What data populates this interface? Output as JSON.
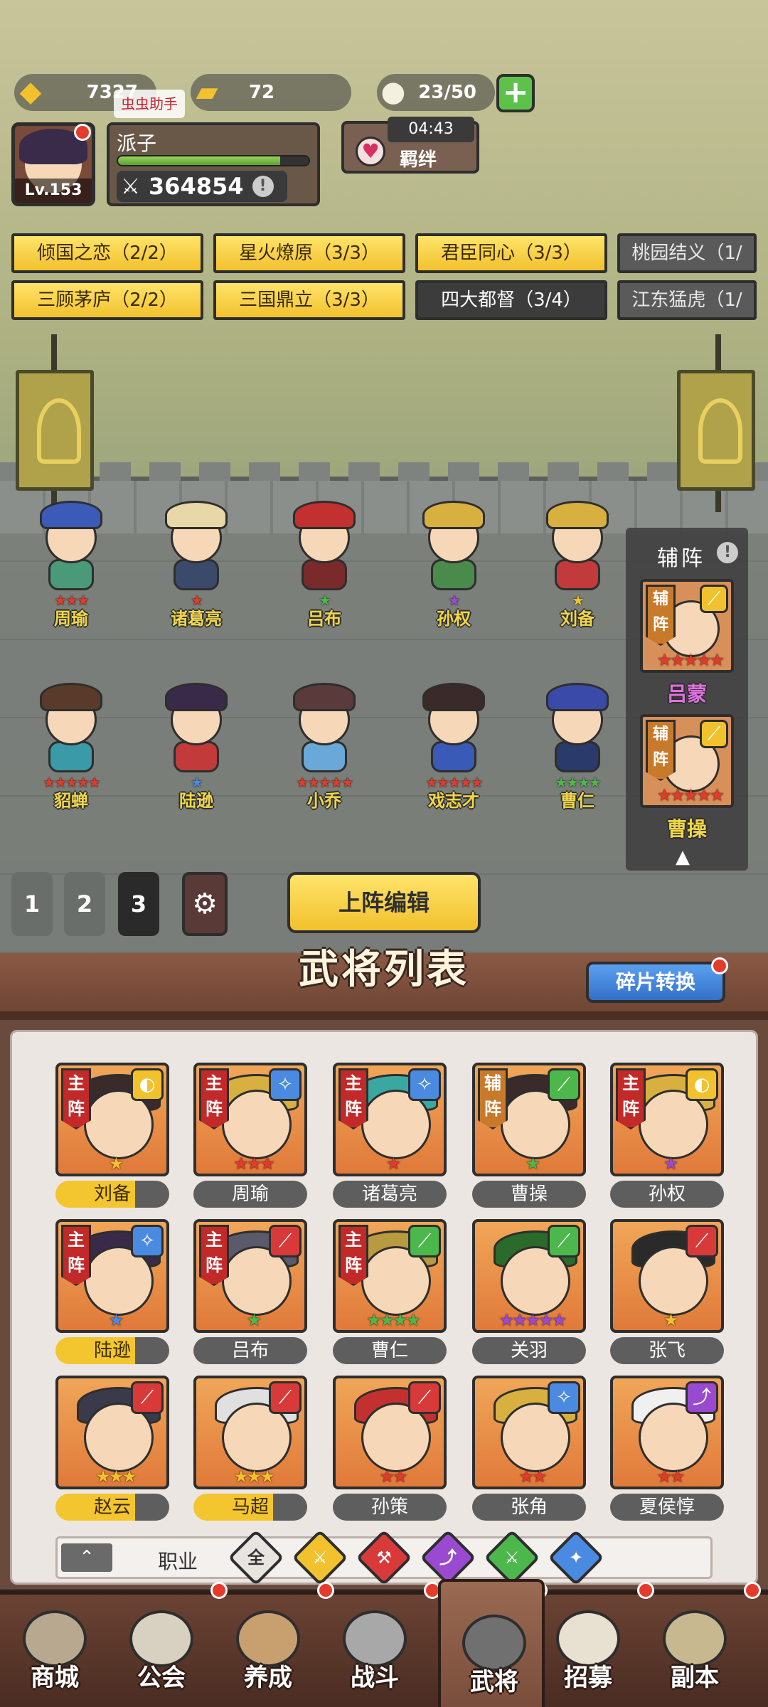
{
  "resources": {
    "gold": "7327",
    "tickets": "72",
    "stamina": "23/50",
    "plus": "+",
    "assistant_tag": "虫虫助手"
  },
  "player": {
    "level": "Lv.153",
    "name": "派子",
    "power": "364854",
    "info": "!",
    "xp_fraction": 0.85
  },
  "fetter": {
    "timer": "04:43",
    "label": "羁绊",
    "heart": "♥"
  },
  "synergies": [
    {
      "label": "倾国之恋（2/2）",
      "state": "on"
    },
    {
      "label": "星火燎原（3/3）",
      "state": "on"
    },
    {
      "label": "君臣同心（3/3）",
      "state": "on"
    },
    {
      "label": "桃园结义（1/",
      "state": "dim"
    },
    {
      "label": "三顾茅庐（2/2）",
      "state": "on"
    },
    {
      "label": "三国鼎立（3/3）",
      "state": "on"
    },
    {
      "label": "四大都督（3/4）",
      "state": "off"
    },
    {
      "label": "江东猛虎（1/",
      "state": "dim"
    }
  ],
  "field_heroes": [
    {
      "name": "周瑜",
      "stars": "★★★",
      "star_color": "#e23b2b",
      "hat": "#3c5ab8",
      "torso": "#4a9a7a"
    },
    {
      "name": "诸葛亮",
      "stars": "★",
      "star_color": "#e23b2b",
      "hat": "#e8d8a8",
      "torso": "#3a4a6a"
    },
    {
      "name": "吕布",
      "stars": "★",
      "star_color": "#4cb84c",
      "hat": "#c23030",
      "torso": "#7a2a2a"
    },
    {
      "name": "孙权",
      "stars": "★",
      "star_color": "#9a4ad0",
      "hat": "#d8b040",
      "torso": "#4a8a4a"
    },
    {
      "name": "刘备",
      "stars": "★",
      "star_color": "#f2c12e",
      "hat": "#d8b040",
      "torso": "#c23a3a"
    },
    {
      "name": "貂蝉",
      "stars": "★★★★★",
      "star_color": "#e23b2b",
      "hat": "#5a3a2a",
      "torso": "#3a9aa8"
    },
    {
      "name": "陆逊",
      "stars": "★",
      "star_color": "#4a8ae0",
      "hat": "#3a2a4a",
      "torso": "#c23a3a"
    },
    {
      "name": "小乔",
      "stars": "★★★★★",
      "star_color": "#e23b2b",
      "hat": "#5a3a3a",
      "torso": "#6aa8d8"
    },
    {
      "name": "戏志才",
      "stars": "★★★★★",
      "star_color": "#e23b2b",
      "hat": "#3a2a2a",
      "torso": "#3a5ab8"
    },
    {
      "name": "曹仁",
      "stars": "★★★★",
      "star_color": "#4cb84c",
      "hat": "#3a4aa8",
      "torso": "#2a3a6a"
    }
  ],
  "assist": {
    "title": "辅阵",
    "info": "!",
    "role_label": "辅阵",
    "slots": [
      {
        "name": "吕蒙",
        "stars": "★★★★★",
        "name_color": "#e070e0"
      },
      {
        "name": "曹操",
        "stars": "★★★★★",
        "name_color": "#f0d64a"
      }
    ],
    "collapse": "▲"
  },
  "formation": {
    "tabs": [
      "1",
      "2",
      "3"
    ],
    "active": "3",
    "gear": "⚙",
    "edit_label": "上阵编辑"
  },
  "list": {
    "title": "武将列表",
    "fragment_button": "碎片转换",
    "cards": [
      {
        "name": "刘备",
        "role": "主阵",
        "class": "bow",
        "stars": "★",
        "star_color": "#f2c12e",
        "gold": true,
        "hair": "#3a2a2a"
      },
      {
        "name": "周瑜",
        "role": "主阵",
        "class": "staff",
        "stars": "★★★",
        "star_color": "#e23b2b",
        "gold": false,
        "hair": "#d8b040"
      },
      {
        "name": "诸葛亮",
        "role": "主阵",
        "class": "staff",
        "stars": "★",
        "star_color": "#e23b2b",
        "gold": false,
        "hair": "#3aa8a0"
      },
      {
        "name": "曹操",
        "role": "辅阵",
        "class": "sword",
        "stars": "★",
        "star_color": "#4cb84c",
        "gold": false,
        "hair": "#3a2a2a"
      },
      {
        "name": "孙权",
        "role": "主阵",
        "class": "bow",
        "stars": "★",
        "star_color": "#9a4ad0",
        "gold": false,
        "hair": "#d8b040"
      },
      {
        "name": "陆逊",
        "role": "主阵",
        "class": "staff",
        "stars": "★",
        "star_color": "#4a8ae0",
        "gold": true,
        "hair": "#3a2a4a"
      },
      {
        "name": "吕布",
        "role": "主阵",
        "class": "blade",
        "stars": "★",
        "star_color": "#4cb84c",
        "gold": false,
        "hair": "#5a5a6a"
      },
      {
        "name": "曹仁",
        "role": "主阵",
        "class": "sword",
        "stars": "★★★★",
        "star_color": "#4cb84c",
        "gold": false,
        "hair": "#b89a40"
      },
      {
        "name": "关羽",
        "role": "",
        "class": "sword",
        "stars": "★★★★★",
        "star_color": "#9a4ad0",
        "gold": false,
        "hair": "#2a6a2a"
      },
      {
        "name": "张飞",
        "role": "",
        "class": "blade",
        "stars": "★",
        "star_color": "#f2c12e",
        "gold": false,
        "hair": "#2a2a2a"
      },
      {
        "name": "赵云",
        "role": "",
        "class": "blade",
        "stars": "★★★",
        "star_color": "#f2c12e",
        "gold": true,
        "hair": "#3a3a4a"
      },
      {
        "name": "马超",
        "role": "",
        "class": "blade",
        "stars": "★★★",
        "star_color": "#f2c12e",
        "gold": true,
        "hair": "#e0e0e0"
      },
      {
        "name": "孙策",
        "role": "",
        "class": "blade",
        "stars": "★★",
        "star_color": "#e23b2b",
        "gold": false,
        "hair": "#c23030"
      },
      {
        "name": "张角",
        "role": "",
        "class": "staff",
        "stars": "★★",
        "star_color": "#e23b2b",
        "gold": false,
        "hair": "#d8b040"
      },
      {
        "name": "夏侯惇",
        "role": "",
        "class": "bow2",
        "stars": "★★",
        "star_color": "#e23b2b",
        "gold": false,
        "hair": "#f0f0f0"
      }
    ]
  },
  "filter": {
    "collapse": "⌃",
    "label": "职业",
    "options": [
      {
        "label": "全",
        "color": "#e8e4e0",
        "text": "#333"
      },
      {
        "label": "⚔",
        "color": "#f2c12e",
        "text": "#fff"
      },
      {
        "label": "⚒",
        "color": "#d83a3a",
        "text": "#fff"
      },
      {
        "label": "⤴",
        "color": "#9a4ad0",
        "text": "#fff"
      },
      {
        "label": "⚔",
        "color": "#4cb84c",
        "text": "#fff"
      },
      {
        "label": "✦",
        "color": "#4a8ae0",
        "text": "#fff"
      }
    ]
  },
  "nav": [
    {
      "label": "商城",
      "color": "#b8a890"
    },
    {
      "label": "公会",
      "color": "#d8d0c0"
    },
    {
      "label": "养成",
      "color": "#c8a070"
    },
    {
      "label": "战斗",
      "color": "#a8a8a8"
    },
    {
      "label": "武将",
      "color": "#707070"
    },
    {
      "label": "招募",
      "color": "#e8e0d0"
    },
    {
      "label": "副本",
      "color": "#c8b890"
    }
  ],
  "nav_active": "武将",
  "class_colors": {
    "bow": "#f2c12e",
    "staff": "#4a8ae0",
    "sword": "#4cb84c",
    "blade": "#d83a3a",
    "bow2": "#9a4ad0"
  },
  "class_glyphs": {
    "bow": "◐",
    "staff": "✧",
    "sword": "⟋",
    "blade": "⟋",
    "bow2": "⤴"
  }
}
